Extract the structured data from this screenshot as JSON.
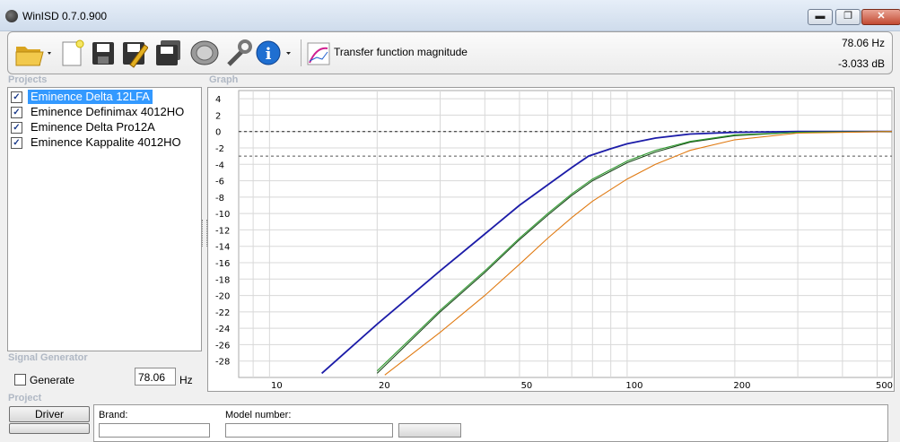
{
  "window": {
    "title": "WinISD 0.7.0.900",
    "minimize": "▬",
    "maximize": "❐",
    "close": "✕"
  },
  "toolbar": {
    "graph_type": "Transfer function magnitude",
    "cursor_freq": "78.06 Hz",
    "cursor_level": "-3.033 dB",
    "icons": [
      "open-folder-icon",
      "new-project-icon",
      "save-icon",
      "edit-icon",
      "save-all-icon",
      "driver-icon",
      "wrench-icon",
      "info-icon",
      "graph-icon"
    ]
  },
  "projects": {
    "label": "Projects",
    "items": [
      {
        "name": "Eminence Delta 12LFA",
        "checked": true,
        "selected": true
      },
      {
        "name": "Eminence Definimax 4012HO",
        "checked": true,
        "selected": false
      },
      {
        "name": "Eminence Delta Pro12A",
        "checked": true,
        "selected": false
      },
      {
        "name": "Eminence Kappalite 4012HO",
        "checked": true,
        "selected": false
      }
    ]
  },
  "graph": {
    "label": "Graph"
  },
  "signal_generator": {
    "label": "Signal Generator",
    "generate": "Generate",
    "frequency": "78.06",
    "unit": "Hz"
  },
  "project_section": {
    "label": "Project",
    "driver_tab": "Driver",
    "brand_label": "Brand:",
    "model_label": "Model number:"
  },
  "colors": {
    "blue": "#1c1ca8",
    "green": "#2e9a2e",
    "orange": "#e07a12",
    "darkgreen": "#1a4a1a"
  },
  "chart_data": {
    "type": "line",
    "title": "Transfer function magnitude",
    "xscale": "log",
    "xlim": [
      8.2,
      550
    ],
    "ylim": [
      -30,
      5
    ],
    "xticks": [
      10,
      20,
      50,
      100,
      200,
      500
    ],
    "yticks": [
      4,
      2,
      0,
      -2,
      -4,
      -6,
      -8,
      -10,
      -12,
      -14,
      -16,
      -18,
      -20,
      -22,
      -24,
      -26,
      -28
    ],
    "reference_lines": [
      0,
      -3
    ],
    "series": [
      {
        "name": "Eminence Delta 12LFA",
        "color": "#1c1ca8",
        "x": [
          14,
          20,
          30,
          40,
          50,
          60,
          70,
          78,
          90,
          100,
          120,
          150,
          200,
          300,
          550
        ],
        "y": [
          -29.5,
          -23.5,
          -17.0,
          -12.5,
          -9.0,
          -6.5,
          -4.4,
          -3.0,
          -2.1,
          -1.5,
          -0.8,
          -0.3,
          -0.1,
          0,
          0
        ]
      },
      {
        "name": "Eminence Definimax 4012HO",
        "color": "#1a4a1a",
        "x": [
          20,
          30,
          40,
          50,
          60,
          70,
          80,
          100,
          120,
          150,
          200,
          300,
          550
        ],
        "y": [
          -29.5,
          -22.0,
          -17.2,
          -13.2,
          -10.2,
          -7.8,
          -6.0,
          -3.8,
          -2.5,
          -1.3,
          -0.5,
          -0.1,
          0
        ]
      },
      {
        "name": "Eminence Delta Pro12A",
        "color": "#2e9a2e",
        "x": [
          20,
          30,
          40,
          50,
          60,
          70,
          80,
          100,
          120,
          150,
          200,
          300,
          550
        ],
        "y": [
          -29.2,
          -21.8,
          -17.0,
          -13.0,
          -10.0,
          -7.6,
          -5.8,
          -3.6,
          -2.3,
          -1.2,
          -0.4,
          -0.1,
          0
        ]
      },
      {
        "name": "Eminence Kappalite 4012HO",
        "color": "#e07a12",
        "x": [
          21,
          30,
          40,
          50,
          60,
          70,
          80,
          100,
          120,
          150,
          200,
          300,
          550
        ],
        "y": [
          -29.7,
          -24.5,
          -20.0,
          -16.2,
          -13.0,
          -10.5,
          -8.5,
          -5.8,
          -4.0,
          -2.3,
          -1.0,
          -0.2,
          0
        ]
      }
    ]
  }
}
